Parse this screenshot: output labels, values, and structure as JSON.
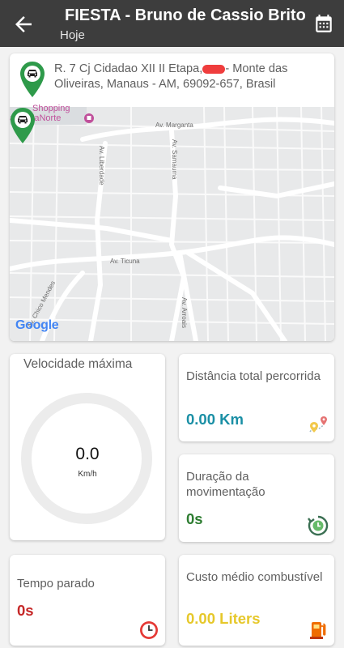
{
  "header": {
    "title": "FIESTA - Bruno de Cassio Brito",
    "subtitle": "Hoje"
  },
  "location": {
    "address_part1": "R. 7 Cj Cidadao XII II Etapa,",
    "address_part2": "- Monte das Oliveiras, Manaus - AM, 69092-657, Brasil"
  },
  "map": {
    "poi_label_1": "Shopping",
    "poi_label_2": "aus ViaNorte",
    "street_marganta": "Av. Marganta",
    "street_liberdade": "Av. Liberdade",
    "street_samauma": "Av. Samauma",
    "street_ticuna": "Av. Ticuna",
    "street_chico_mendes": "Av. Chico Mendes",
    "street_arroais": "Av. Arroais",
    "attribution": "Google"
  },
  "speed": {
    "title": "Velocidade máxima",
    "value": "0.0",
    "unit": "Km/h",
    "gauge_level": 0
  },
  "stats": {
    "distance": {
      "label": "Distância total percorrida",
      "value": "0.00 Km",
      "color": "#1a8fa5"
    },
    "duration": {
      "label": "Duração da movimentação",
      "value": "0s",
      "color": "#2e7d32"
    },
    "stopped": {
      "label": "Tempo parado",
      "value": "0s",
      "color": "#c62828"
    },
    "fuel": {
      "label": "Custo médio combustível",
      "value": "0.00 Liters",
      "color": "#e6c82b"
    }
  },
  "colors": {
    "appbar": "#3d3d3d",
    "pin_green": "#2e9a4a",
    "background": "#f2f2f2"
  },
  "icons": [
    "back-arrow-icon",
    "calendar-icon",
    "car-location-pin-icon",
    "map-route-icon",
    "refresh-clock-icon",
    "alarm-clock-icon",
    "fuel-pump-icon"
  ]
}
